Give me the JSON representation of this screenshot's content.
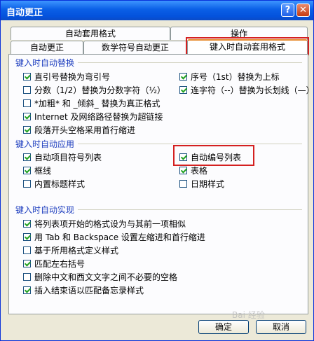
{
  "window": {
    "title": "自动更正",
    "help_label": "?",
    "close_label": "✕"
  },
  "tabs_row1": [
    {
      "label": "自动套用格式"
    },
    {
      "label": "操作"
    }
  ],
  "tabs_row2": [
    {
      "label": "自动更正"
    },
    {
      "label": "数学符号自动更正"
    },
    {
      "label": "键入时自动套用格式"
    }
  ],
  "sections": [
    {
      "title": "键入时自动替换"
    },
    {
      "title": "键入时自动应用"
    },
    {
      "title": "键入时自动实现"
    }
  ],
  "replace_items": [
    {
      "label": "直引号替换为弯引号",
      "checked": true
    },
    {
      "label": "序号（1st）替换为上标",
      "checked": true
    },
    {
      "label": "分数（1/2）替换为分数字符（½）",
      "checked": false
    },
    {
      "label": "连字符（--）替换为长划线（—）",
      "checked": true
    },
    {
      "label": "*加粗* 和 _倾斜_ 替换为真正格式",
      "checked": false
    },
    {
      "label": "Internet 及网络路径替换为超链接",
      "checked": true
    },
    {
      "label": "段落开头空格采用首行缩进",
      "checked": true
    }
  ],
  "apply_items": [
    {
      "label": "自动项目符号列表",
      "checked": true
    },
    {
      "label": "自动编号列表",
      "checked": true
    },
    {
      "label": "框线",
      "checked": true
    },
    {
      "label": "表格",
      "checked": true
    },
    {
      "label": "内置标题样式",
      "checked": false
    },
    {
      "label": "日期样式",
      "checked": false
    }
  ],
  "auto_items": [
    {
      "label": "将列表项开始的格式设为与其前一项相似",
      "checked": true
    },
    {
      "label": "用 Tab 和 Backspace 设置左缩进和首行缩进",
      "checked": true
    },
    {
      "label": "基于所用格式定义样式",
      "checked": false
    },
    {
      "label": "匹配左右括号",
      "checked": true
    },
    {
      "label": "删除中文和西文文字之间不必要的空格",
      "checked": false
    },
    {
      "label": "插入结束语以匹配备忘录样式",
      "checked": true
    }
  ],
  "buttons": {
    "ok": "确定",
    "cancel": "取消"
  },
  "watermark": "Bai 经验",
  "colors": {
    "accent": "#0a5fe6",
    "highlight": "#d42020",
    "section": "#1f3fbf"
  }
}
